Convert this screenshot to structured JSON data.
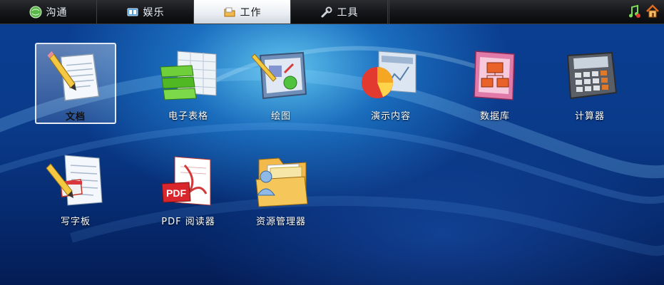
{
  "tabs": [
    {
      "label": "沟通",
      "icon": "globe-icon",
      "active": false
    },
    {
      "label": "娱乐",
      "icon": "media-player-icon",
      "active": false
    },
    {
      "label": "工作",
      "icon": "folder-icon",
      "active": true
    },
    {
      "label": "工具",
      "icon": "wrench-icon",
      "active": false
    }
  ],
  "corner": {
    "music_icon": "music-note-icon",
    "home_icon": "home-icon"
  },
  "apps": [
    {
      "label": "文档",
      "icon": "document-pencil-icon",
      "selected": true
    },
    {
      "label": "电子表格",
      "icon": "spreadsheet-icon",
      "selected": false
    },
    {
      "label": "绘图",
      "icon": "drawing-icon",
      "selected": false
    },
    {
      "label": "演示内容",
      "icon": "presentation-chart-icon",
      "selected": false
    },
    {
      "label": "数据库",
      "icon": "database-icon",
      "selected": false
    },
    {
      "label": "计算器",
      "icon": "calculator-icon",
      "selected": false
    },
    {
      "label": "写字板",
      "icon": "wordpad-icon",
      "selected": false
    },
    {
      "label": "PDF 阅读器",
      "icon": "pdf-reader-icon",
      "selected": false
    },
    {
      "label": "资源管理器",
      "icon": "file-explorer-icon",
      "selected": false
    }
  ],
  "colors": {
    "accent": "#1f7fe0",
    "tab_active": "#ffffff",
    "bar": "#141518"
  }
}
